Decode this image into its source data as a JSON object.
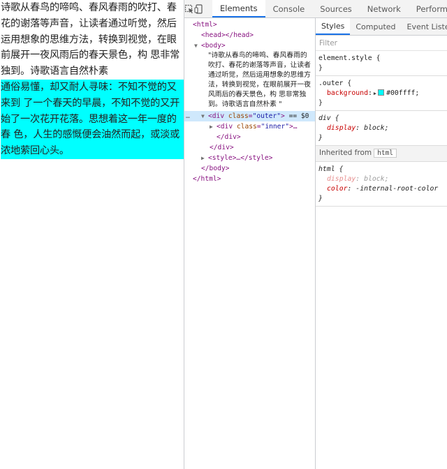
{
  "page": {
    "text_before": "诗歌从春鸟的啼鸣、春风春雨的吹打、春花的谢落等声音，让读者通过听觉，然后运用想象的思维方法，转换到视觉，在眼前展开一夜风雨后的春天景色，构 思非常独到。诗歌语言自然朴素",
    "outer_text": "通俗易懂，却又耐人寻味：不知不觉的又来到 了一个春天的早晨，不知不觉的又开始了一次花开花落。思想着这一年一度的春 色，人生的感慨便会油然而起，或淡或浓地萦回心头。"
  },
  "devtools": {
    "tabs": [
      "Elements",
      "Console",
      "Sources",
      "Network",
      "Performa"
    ],
    "active_tab": "Elements",
    "dom": {
      "html_open": "<html>",
      "head": "<head></head>",
      "body_open": "<body>",
      "text_node": "\"诗歌从春鸟的啼鸣、春风春雨的吹打、春花的谢落等声音，让读者通过听觉，然后运用想象的思维方法，转换到视觉，在眼前展开一夜风雨后的春天景色，构 思非常独到。诗歌语言自然朴素 \"",
      "div_outer_tag": "div",
      "div_outer_attr": "class",
      "div_outer_val": "\"outer\"",
      "div_outer_suffix": "== $0",
      "div_inner_tag": "div",
      "div_inner_attr": "class",
      "div_inner_val": "\"inner\"",
      "div_inner_suffix": ">…",
      "div_close_1": "</div>",
      "div_close_2": "</div>",
      "style_line": "<style>…</style>",
      "body_close": "</body>",
      "html_close": "</html>"
    },
    "styles": {
      "tabs": [
        "Styles",
        "Computed",
        "Event Listene"
      ],
      "active_tab": "Styles",
      "filter_placeholder": "Filter",
      "rules": [
        {
          "selector": "element.style {",
          "close": "}"
        },
        {
          "selector": ".outer {",
          "prop": "background",
          "value": "#00ffff;",
          "close": "}"
        },
        {
          "selector": "div {",
          "prop": "display",
          "value": "block;",
          "close": "}"
        }
      ],
      "inherited_label": "Inherited from",
      "inherited_from": "html",
      "html_rule": {
        "selector": "html {",
        "prop1": "display",
        "val1": "block;",
        "prop2": "color",
        "val2": "-internal-root-color",
        "close": "}"
      }
    }
  },
  "colors": {
    "outer_background": "#00ffff",
    "accent": "#1a73e8"
  },
  "icons": [
    "inspect-element-icon",
    "device-toggle-icon"
  ]
}
